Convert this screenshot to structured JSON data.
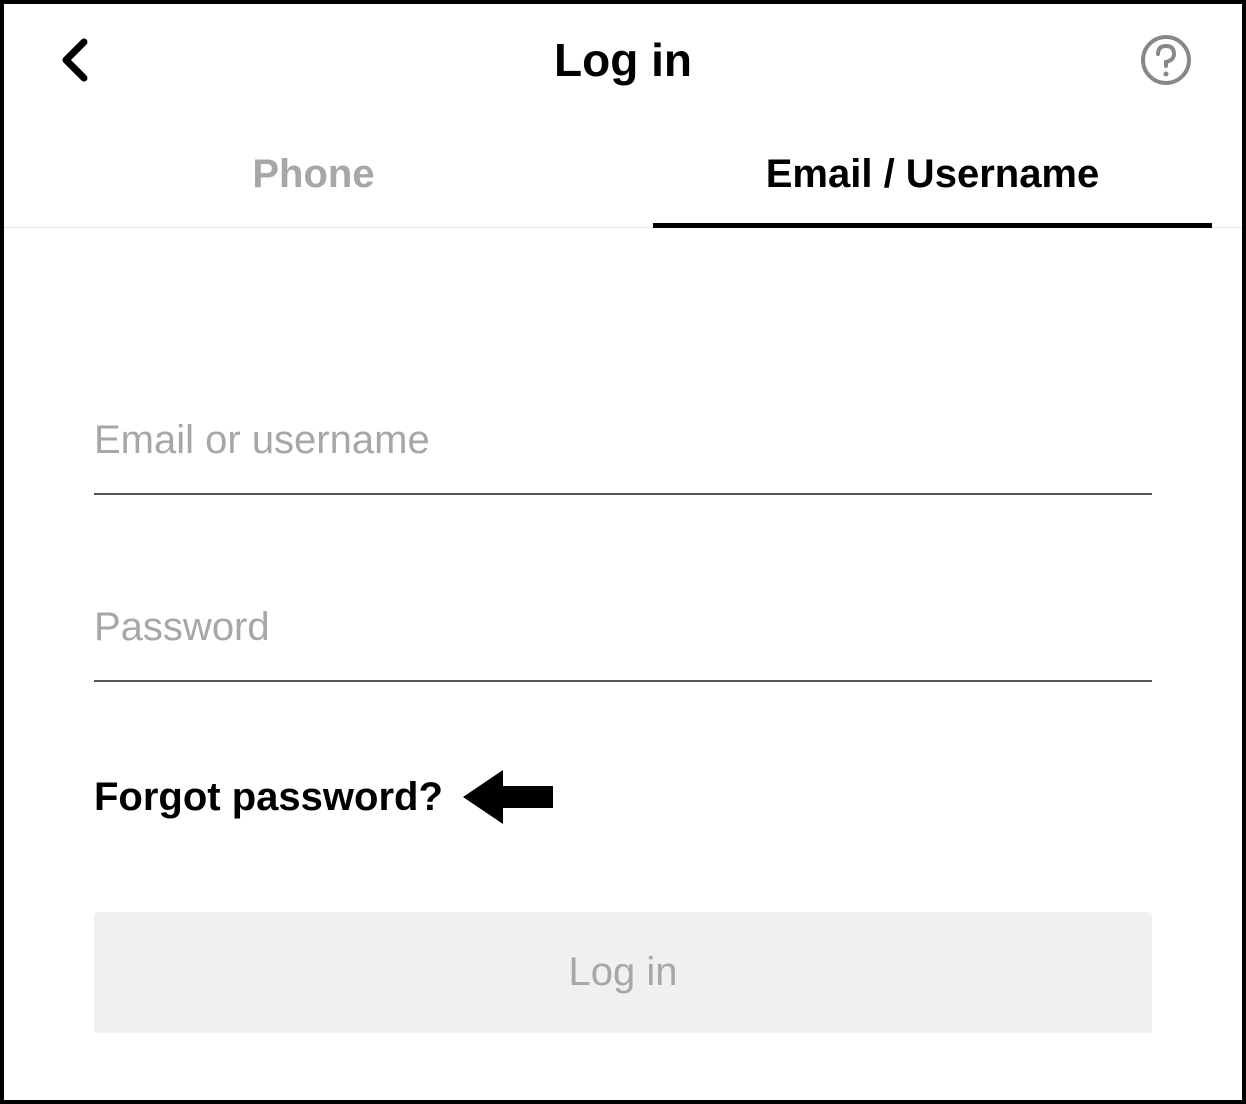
{
  "header": {
    "title": "Log in"
  },
  "tabs": {
    "phone": "Phone",
    "email": "Email / Username"
  },
  "form": {
    "username_placeholder": "Email or username",
    "password_placeholder": "Password",
    "forgot_label": "Forgot password?",
    "login_button_label": "Log in"
  }
}
